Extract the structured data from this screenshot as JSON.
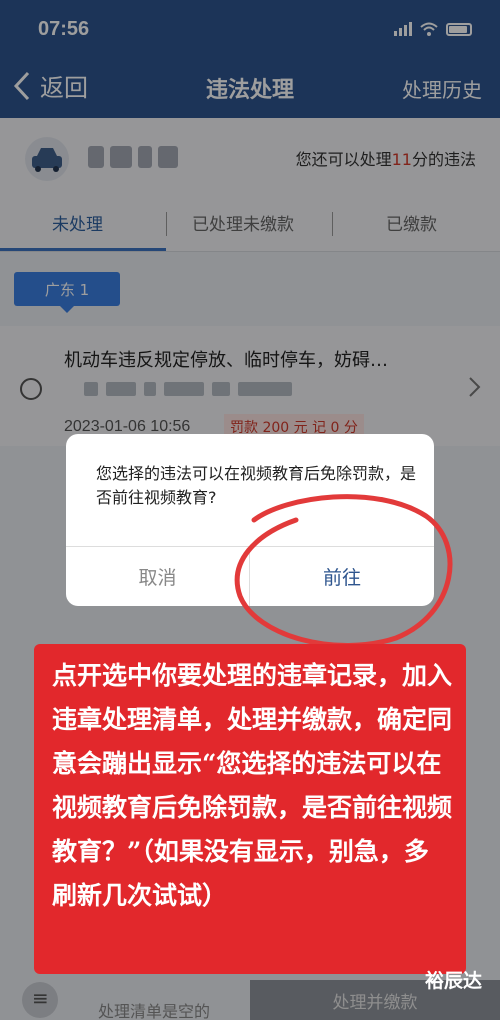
{
  "status_bar": {
    "time": "07:56"
  },
  "nav": {
    "back_label": "返回",
    "title": "违法处理",
    "history_label": "处理历史"
  },
  "user": {
    "remaining_prefix": "您还可以处理",
    "remaining_count": "11",
    "remaining_suffix": "分的违法"
  },
  "tabs": [
    {
      "label": "未处理",
      "active": true
    },
    {
      "label": "已处理未缴款",
      "active": false
    },
    {
      "label": "已缴款",
      "active": false
    }
  ],
  "province_badge": "广东 1",
  "violation": {
    "title": "机动车违反规定停放、临时停车，妨碍…",
    "time": "2023-01-06 10:56",
    "fine": "罚款 200 元  记 0 分"
  },
  "dialog": {
    "message": "您选择的违法可以在视频教育后免除罚款，是否前往视频教育?",
    "cancel_label": "取消",
    "confirm_label": "前往"
  },
  "annotation": {
    "text": "点开选中你要处理的违章记录，加入违章处理清单，处理并缴款，确定同意会蹦出显示“您选择的违法可以在视频教育后免除罚款，是否前往视频教育？”（如果没有显示，别急，多刷新几次试试）"
  },
  "bottom_bar": {
    "empty_text": "处理清单是空的",
    "pay_label": "处理并缴款"
  },
  "watermark": "裕辰达",
  "colors": {
    "nav_bg": "#2e558e",
    "accent": "#3c73c1",
    "alert_red": "#e2282c"
  },
  "icons": [
    "back-chevron-icon",
    "car-icon",
    "chevron-right-icon",
    "list-icon",
    "signal-icon",
    "wifi-icon",
    "battery-icon"
  ]
}
